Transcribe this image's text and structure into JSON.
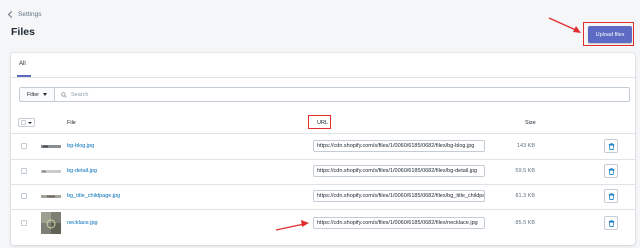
{
  "breadcrumb": {
    "label": "Settings"
  },
  "page": {
    "title": "Files"
  },
  "upload_button": {
    "label": "Upload files"
  },
  "tabs": [
    {
      "label": "All",
      "selected": true
    }
  ],
  "filter": {
    "label": "Filter",
    "search_placeholder": "Search"
  },
  "table": {
    "headers": {
      "file": "File",
      "url": "URL",
      "size": "Size"
    },
    "rows": [
      {
        "name": "bg-blog.jpg",
        "url": "https://cdn.shopify.com/s/files/1/0060/6185/0682/files/bg-blog.jpg",
        "size": "143 KB",
        "thumb": "bg-blog"
      },
      {
        "name": "bg-detail.jpg",
        "url": "https://cdn.shopify.com/s/files/1/0060/6185/0682/files/bg-detail.jpg",
        "size": "59.5 KB",
        "thumb": "bg-detail"
      },
      {
        "name": "bg_title_childpage.jpg",
        "url": "https://cdn.shopify.com/s/files/1/0060/6185/0682/files/bg_title_childpage.jpg",
        "size": "81.3 KB",
        "thumb": "bg-title"
      },
      {
        "name": "necklace.jpg",
        "url": "https://cdn.shopify.com/s/files/1/0060/6185/0682/files/necklace.jpg",
        "size": "85.5 KB",
        "thumb": "necklace"
      }
    ]
  },
  "colors": {
    "primary": "#5c6ac4",
    "link": "#006fbb",
    "annotation": "#e02d2d",
    "delete_icon": "#006fbb"
  },
  "icons": {
    "back": "chevron-left-icon",
    "filter": "caret-down-icon",
    "search": "search-icon",
    "delete": "trash-icon"
  }
}
